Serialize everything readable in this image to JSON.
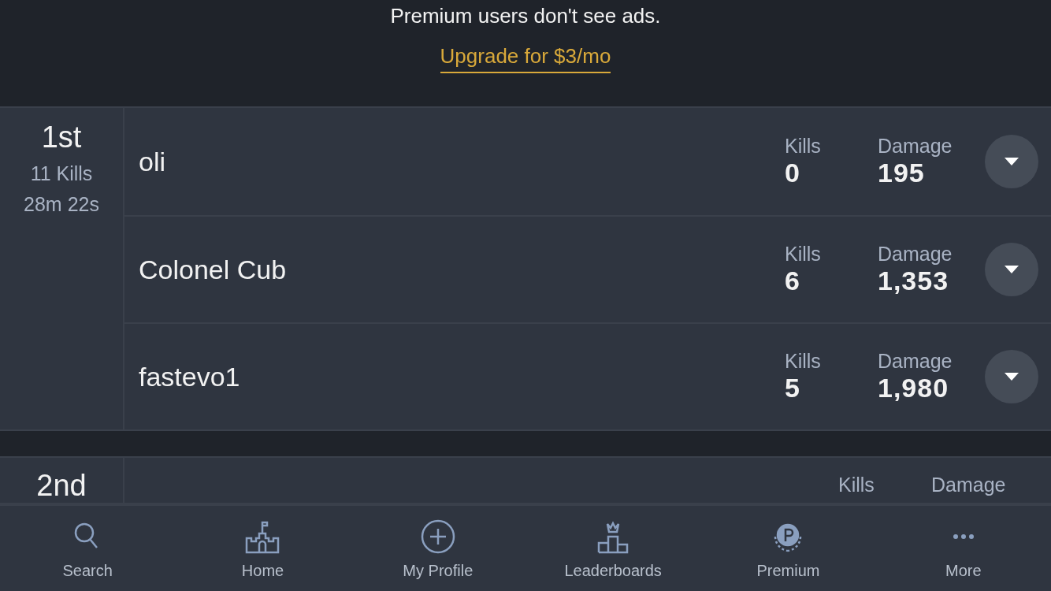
{
  "ad": {
    "message": "Premium users don't see ads.",
    "link": "Upgrade for $3/mo"
  },
  "matches": [
    {
      "rank": "1st",
      "kills": "11 Kills",
      "time": "28m 22s",
      "players": [
        {
          "name": "oli",
          "kills_label": "Kills",
          "kills": "0",
          "damage_label": "Damage",
          "damage": "195"
        },
        {
          "name": "Colonel Cub",
          "kills_label": "Kills",
          "kills": "6",
          "damage_label": "Damage",
          "damage": "1,353"
        },
        {
          "name": "fastevo1",
          "kills_label": "Kills",
          "kills": "5",
          "damage_label": "Damage",
          "damage": "1,980"
        }
      ]
    },
    {
      "rank": "2nd",
      "players": [
        {
          "kills_label": "Kills",
          "damage_label": "Damage"
        }
      ]
    }
  ],
  "nav": [
    {
      "kind": "search",
      "label": "Search",
      "selected": false
    },
    {
      "kind": "home",
      "label": "Home",
      "selected": false
    },
    {
      "kind": "profile",
      "label": "My Profile",
      "selected": false
    },
    {
      "kind": "leaderboards",
      "label": "Leaderboards",
      "selected": false
    },
    {
      "kind": "premium",
      "label": "Premium",
      "selected": false
    },
    {
      "kind": "more",
      "label": "More",
      "selected": false
    }
  ]
}
